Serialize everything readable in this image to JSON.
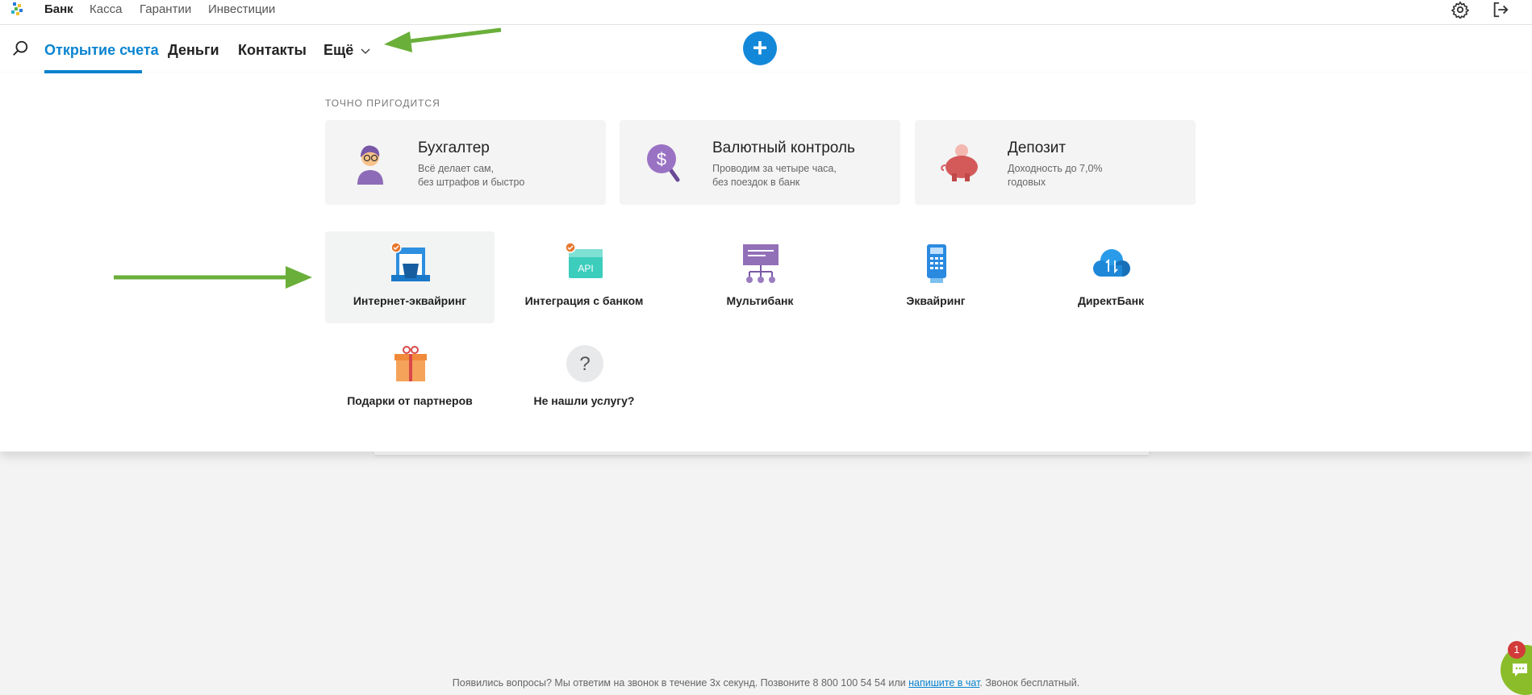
{
  "topbar": {
    "links": [
      "Банк",
      "Касса",
      "Гарантии",
      "Инвестиции"
    ],
    "active": "Банк",
    "icons": [
      "gear-icon",
      "logout-icon"
    ]
  },
  "nav": {
    "tabs": [
      "Открытие счета",
      "Деньги",
      "Контакты",
      "Ещё"
    ],
    "active": "Открытие счета",
    "add_icon": "plus-icon"
  },
  "dropdown": {
    "section_title": "ТОЧНО ПРИГОДИТСЯ",
    "cards": [
      {
        "title": "Бухгалтер",
        "line1": "Всё делает сам,",
        "line2": "без штрафов и быстро"
      },
      {
        "title": "Валютный контроль",
        "line1": "Проводим за четыре часа,",
        "line2": "без поездок в банк"
      },
      {
        "title": "Депозит",
        "line1": "Доходность до 7,0%",
        "line2": "годовых"
      }
    ],
    "services": [
      {
        "label": "Интернет-эквайринг"
      },
      {
        "label": "Интеграция с банком",
        "icon_text": "API"
      },
      {
        "label": "Мультибанк"
      },
      {
        "label": "Эквайринг"
      },
      {
        "label": "ДиректБанк"
      },
      {
        "label": "Подарки от партнеров"
      },
      {
        "label": "Не нашли услугу?",
        "icon_text": "?"
      }
    ]
  },
  "footer": {
    "before": "Появились вопросы? Мы ответим на звонок в течение 3х секунд. Позвоните 8 800 100 54 54 или ",
    "link": "напишите в чат",
    "after": ". Звонок бесплатный."
  },
  "chat": {
    "badge": "1"
  },
  "colors": {
    "accent": "#0a84d0",
    "annotation": "#6aaf3a",
    "chat": "#8bbd2a"
  }
}
